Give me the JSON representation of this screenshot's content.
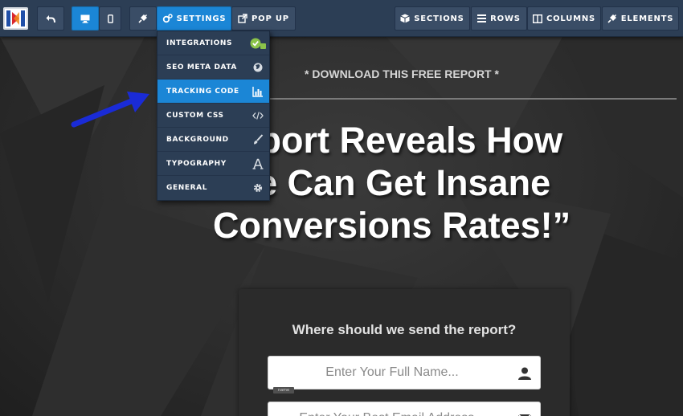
{
  "toolbar": {
    "settings_label": "SETTINGS",
    "popup_label": "POP UP",
    "sections_label": "SECTIONS",
    "rows_label": "ROWS",
    "columns_label": "COLUMNS",
    "elements_label": "ELEMENTS"
  },
  "settings_menu": {
    "items": [
      {
        "label": "INTEGRATIONS",
        "icon": "integrations-check-icon"
      },
      {
        "label": "SEO META DATA",
        "icon": "globe-icon"
      },
      {
        "label": "TRACKING CODE",
        "icon": "bar-chart-icon"
      },
      {
        "label": "CUSTOM CSS",
        "icon": "code-icon"
      },
      {
        "label": "BACKGROUND",
        "icon": "brush-icon"
      },
      {
        "label": "TYPOGRAPHY",
        "icon": "font-icon"
      },
      {
        "label": "GENERAL",
        "icon": "gear-icon"
      }
    ],
    "highlighted": "TRACKING CODE"
  },
  "page": {
    "preheadline": "* DOWNLOAD THIS FREE REPORT *",
    "headline_lines": [
      "Report Reveals How",
      "one Can Get Insane",
      "Conversions Rates!”"
    ],
    "form": {
      "title": "Where should we send the report?",
      "name_placeholder": "Enter Your Full Name...",
      "name_tag": "name",
      "email_placeholder": "Enter Your Best Email Address..."
    }
  },
  "colors": {
    "toolbar_bg": "#2c3e55",
    "accent": "#1b86d6",
    "annotation_arrow": "#1a2bd6"
  }
}
